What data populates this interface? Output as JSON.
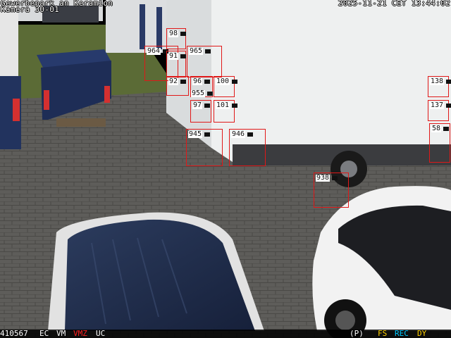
{
  "osd": {
    "location": "Gewerbepark an Keramion",
    "camera": "Kamera 30-01",
    "datetime": "2025-11-21 CET 13:44:02"
  },
  "status_bar": {
    "frame_id": "410567",
    "items": [
      {
        "text": "EC",
        "color": "#ffffff"
      },
      {
        "text": "VM",
        "color": "#ffffff"
      },
      {
        "text": "VMZ",
        "color": "#ff2020"
      },
      {
        "text": "UC",
        "color": "#ffffff"
      }
    ],
    "right_items": [
      {
        "text": "(P)",
        "color": "#ffffff"
      },
      {
        "text": "FS",
        "color": "#ffd000"
      },
      {
        "text": "REC",
        "color": "#00c8ff"
      },
      {
        "text": "DY",
        "color": "#ffd000"
      }
    ]
  },
  "detections": [
    {
      "label": "98"
    },
    {
      "label": "964"
    },
    {
      "label": "965"
    },
    {
      "label": "91"
    },
    {
      "label": "92"
    },
    {
      "label": "96"
    },
    {
      "label": "955"
    },
    {
      "label": "100"
    },
    {
      "label": "97"
    },
    {
      "label": "101"
    },
    {
      "label": "945"
    },
    {
      "label": "946"
    },
    {
      "label": "938"
    },
    {
      "label": "138"
    },
    {
      "label": "137"
    },
    {
      "label": "58"
    }
  ],
  "colors": {
    "box": "#e01818",
    "osd_text": "#ffffff"
  }
}
